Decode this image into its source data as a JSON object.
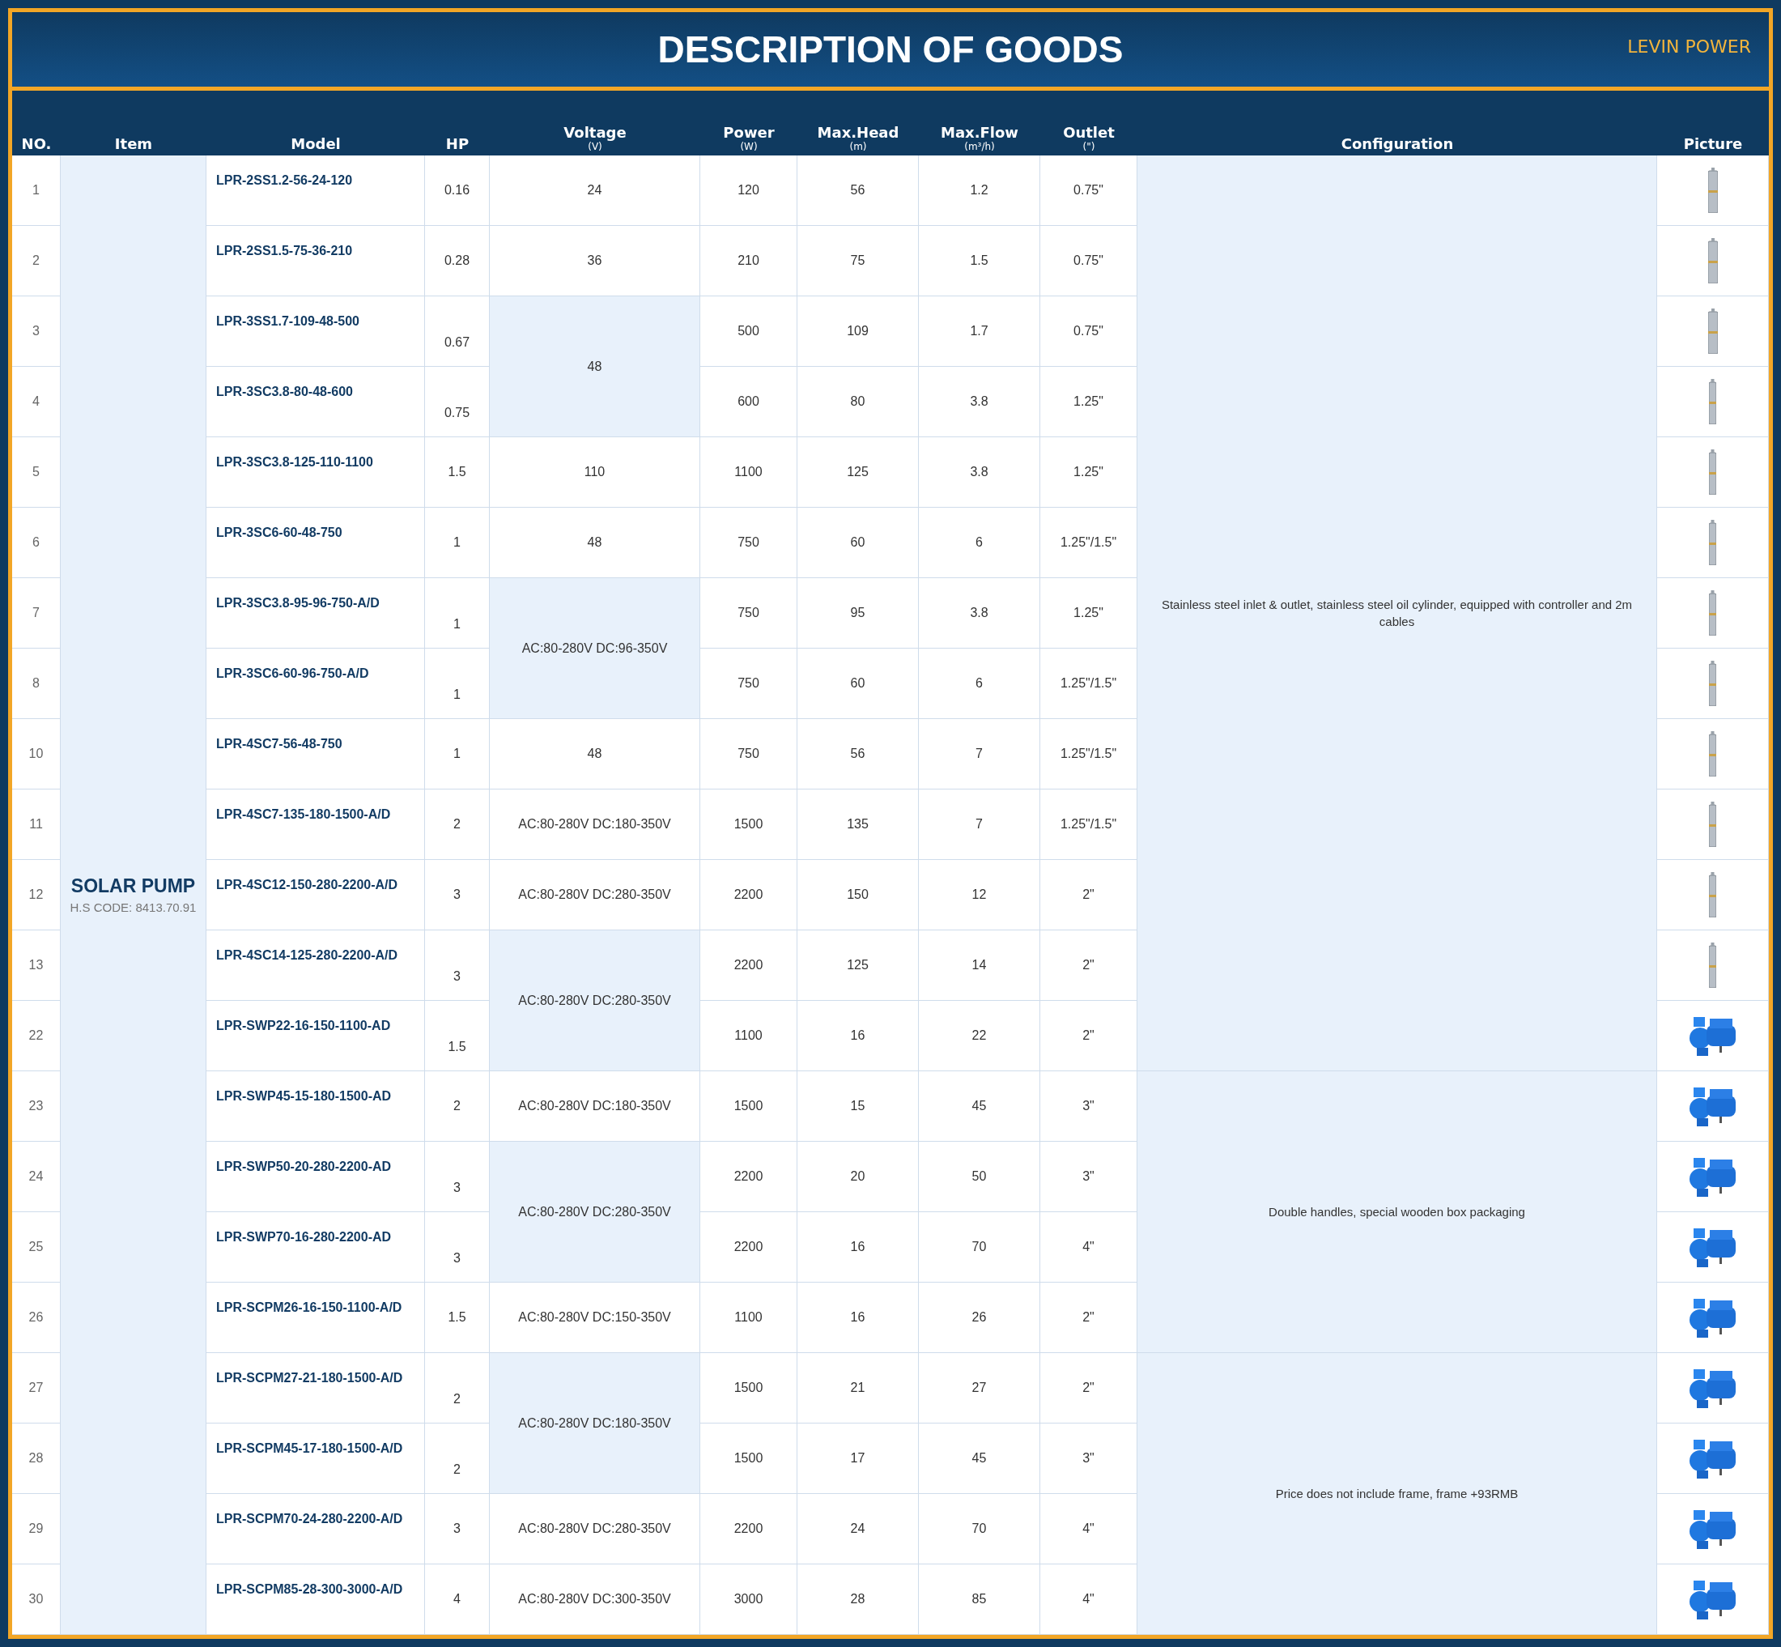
{
  "title": "DESCRIPTION OF GOODS",
  "brand": "LEVIN POWER",
  "columns": [
    {
      "label": "NO."
    },
    {
      "label": "Item"
    },
    {
      "label": "Model"
    },
    {
      "label": "HP"
    },
    {
      "label": "Voltage",
      "unit": "(V)"
    },
    {
      "label": "Power",
      "unit": "(W)"
    },
    {
      "label": "Max.Head",
      "unit": "(m)"
    },
    {
      "label": "Max.Flow",
      "unit": "(m³/h)"
    },
    {
      "label": "Outlet",
      "unit": "(\")"
    },
    {
      "label": "Configuration"
    },
    {
      "label": "Picture"
    }
  ],
  "item": {
    "name": "SOLAR PUMP",
    "code": "H.S CODE: 8413.70.91"
  },
  "configurations": [
    {
      "text": "Stainless steel inlet & outlet, stainless steel oil cylinder, equipped with controller and 2m cables",
      "voltage_groups": [
        {
          "voltage": "24",
          "rows": [
            {
              "no": "1",
              "model": "LPR-2SS1.2-56-24-120",
              "hp": "0.16",
              "power": "120",
              "head": "56",
              "flow": "1.2",
              "outlet": "0.75\"",
              "kind": "submersible"
            }
          ]
        },
        {
          "voltage": "36",
          "rows": [
            {
              "no": "2",
              "model": "LPR-2SS1.5-75-36-210",
              "hp": "0.28",
              "power": "210",
              "head": "75",
              "flow": "1.5",
              "outlet": "0.75\"",
              "kind": "submersible"
            }
          ]
        },
        {
          "voltage": "48",
          "rows": [
            {
              "no": "3",
              "model": "LPR-3SS1.7-109-48-500",
              "hp": "0.67",
              "power": "500",
              "head": "109",
              "flow": "1.7",
              "outlet": "0.75\"",
              "kind": "submersible"
            },
            {
              "no": "4",
              "model": "LPR-3SC3.8-80-48-600",
              "hp": "0.75",
              "power": "600",
              "head": "80",
              "flow": "3.8",
              "outlet": "1.25\"",
              "kind": "slim"
            }
          ]
        },
        {
          "voltage": "110",
          "rows": [
            {
              "no": "5",
              "model": "LPR-3SC3.8-125-110-1100",
              "hp": "1.5",
              "power": "1100",
              "head": "125",
              "flow": "3.8",
              "outlet": "1.25\"",
              "kind": "slim"
            }
          ]
        },
        {
          "voltage": "48",
          "rows": [
            {
              "no": "6",
              "model": "LPR-3SC6-60-48-750",
              "hp": "1",
              "power": "750",
              "head": "60",
              "flow": "6",
              "outlet": "1.25\"/1.5\"",
              "kind": "slim"
            }
          ]
        },
        {
          "voltage": "AC:80-280V DC:96-350V",
          "rows": [
            {
              "no": "7",
              "model": "LPR-3SC3.8-95-96-750-A/D",
              "hp": "1",
              "power": "750",
              "head": "95",
              "flow": "3.8",
              "outlet": "1.25\"",
              "kind": "slim"
            },
            {
              "no": "8",
              "model": "LPR-3SC6-60-96-750-A/D",
              "hp": "1",
              "power": "750",
              "head": "60",
              "flow": "6",
              "outlet": "1.25\"/1.5\"",
              "kind": "slim"
            }
          ]
        },
        {
          "voltage": "48",
          "rows": [
            {
              "no": "10",
              "model": "LPR-4SC7-56-48-750",
              "hp": "1",
              "power": "750",
              "head": "56",
              "flow": "7",
              "outlet": "1.25\"/1.5\"",
              "kind": "slim"
            }
          ]
        },
        {
          "voltage": "AC:80-280V DC:180-350V",
          "rows": [
            {
              "no": "11",
              "model": "LPR-4SC7-135-180-1500-A/D",
              "hp": "2",
              "power": "1500",
              "head": "135",
              "flow": "7",
              "outlet": "1.25\"/1.5\"",
              "kind": "slim"
            }
          ]
        },
        {
          "voltage": "AC:80-280V DC:280-350V",
          "rows": [
            {
              "no": "12",
              "model": "LPR-4SC12-150-280-2200-A/D",
              "hp": "3",
              "power": "2200",
              "head": "150",
              "flow": "12",
              "outlet": "2\"",
              "kind": "slim"
            }
          ]
        },
        {
          "voltage": "AC:80-280V DC:280-350V",
          "rows": [
            {
              "no": "13",
              "model": "LPR-4SC14-125-280-2200-A/D",
              "hp": "3",
              "power": "2200",
              "head": "125",
              "flow": "14",
              "outlet": "2\"",
              "kind": "slim"
            },
            {
              "no": "22",
              "model": "LPR-SWP22-16-150-1100-AD",
              "hp": "1.5",
              "power": "1100",
              "head": "16",
              "flow": "22",
              "outlet": "2\"",
              "kind": "centrifugal"
            }
          ]
        }
      ]
    },
    {
      "text": "Double handles, special wooden box packaging",
      "voltage_groups": [
        {
          "voltage": "AC:80-280V DC:180-350V",
          "rows": [
            {
              "no": "23",
              "model": "LPR-SWP45-15-180-1500-AD",
              "hp": "2",
              "power": "1500",
              "head": "15",
              "flow": "45",
              "outlet": "3\"",
              "kind": "centrifugal"
            }
          ]
        },
        {
          "voltage": "AC:80-280V DC:280-350V",
          "rows": [
            {
              "no": "24",
              "model": "LPR-SWP50-20-280-2200-AD",
              "hp": "3",
              "power": "2200",
              "head": "20",
              "flow": "50",
              "outlet": "3\"",
              "kind": "centrifugal"
            },
            {
              "no": "25",
              "model": "LPR-SWP70-16-280-2200-AD",
              "hp": "3",
              "power": "2200",
              "head": "16",
              "flow": "70",
              "outlet": "4\"",
              "kind": "centrifugal"
            }
          ]
        },
        {
          "voltage": "AC:80-280V DC:150-350V",
          "rows": [
            {
              "no": "26",
              "model": "LPR-SCPM26-16-150-1100-A/D",
              "hp": "1.5",
              "power": "1100",
              "head": "16",
              "flow": "26",
              "outlet": "2\"",
              "kind": "centrifugal"
            }
          ]
        }
      ]
    },
    {
      "text": "Price does not include frame, frame +93RMB",
      "voltage_groups": [
        {
          "voltage": "AC:80-280V DC:180-350V",
          "rows": [
            {
              "no": "27",
              "model": "LPR-SCPM27-21-180-1500-A/D",
              "hp": "2",
              "power": "1500",
              "head": "21",
              "flow": "27",
              "outlet": "2\"",
              "kind": "centrifugal"
            },
            {
              "no": "28",
              "model": "LPR-SCPM45-17-180-1500-A/D",
              "hp": "2",
              "power": "1500",
              "head": "17",
              "flow": "45",
              "outlet": "3\"",
              "kind": "centrifugal"
            }
          ]
        },
        {
          "voltage": "AC:80-280V DC:280-350V",
          "rows": [
            {
              "no": "29",
              "model": "LPR-SCPM70-24-280-2200-A/D",
              "hp": "3",
              "power": "2200",
              "head": "24",
              "flow": "70",
              "outlet": "4\"",
              "kind": "centrifugal"
            }
          ]
        },
        {
          "voltage": "AC:80-280V DC:300-350V",
          "rows": [
            {
              "no": "30",
              "model": "LPR-SCPM85-28-300-3000-A/D",
              "hp": "4",
              "power": "3000",
              "head": "28",
              "flow": "85",
              "outlet": "4\"",
              "kind": "centrifugal"
            }
          ]
        }
      ]
    }
  ]
}
